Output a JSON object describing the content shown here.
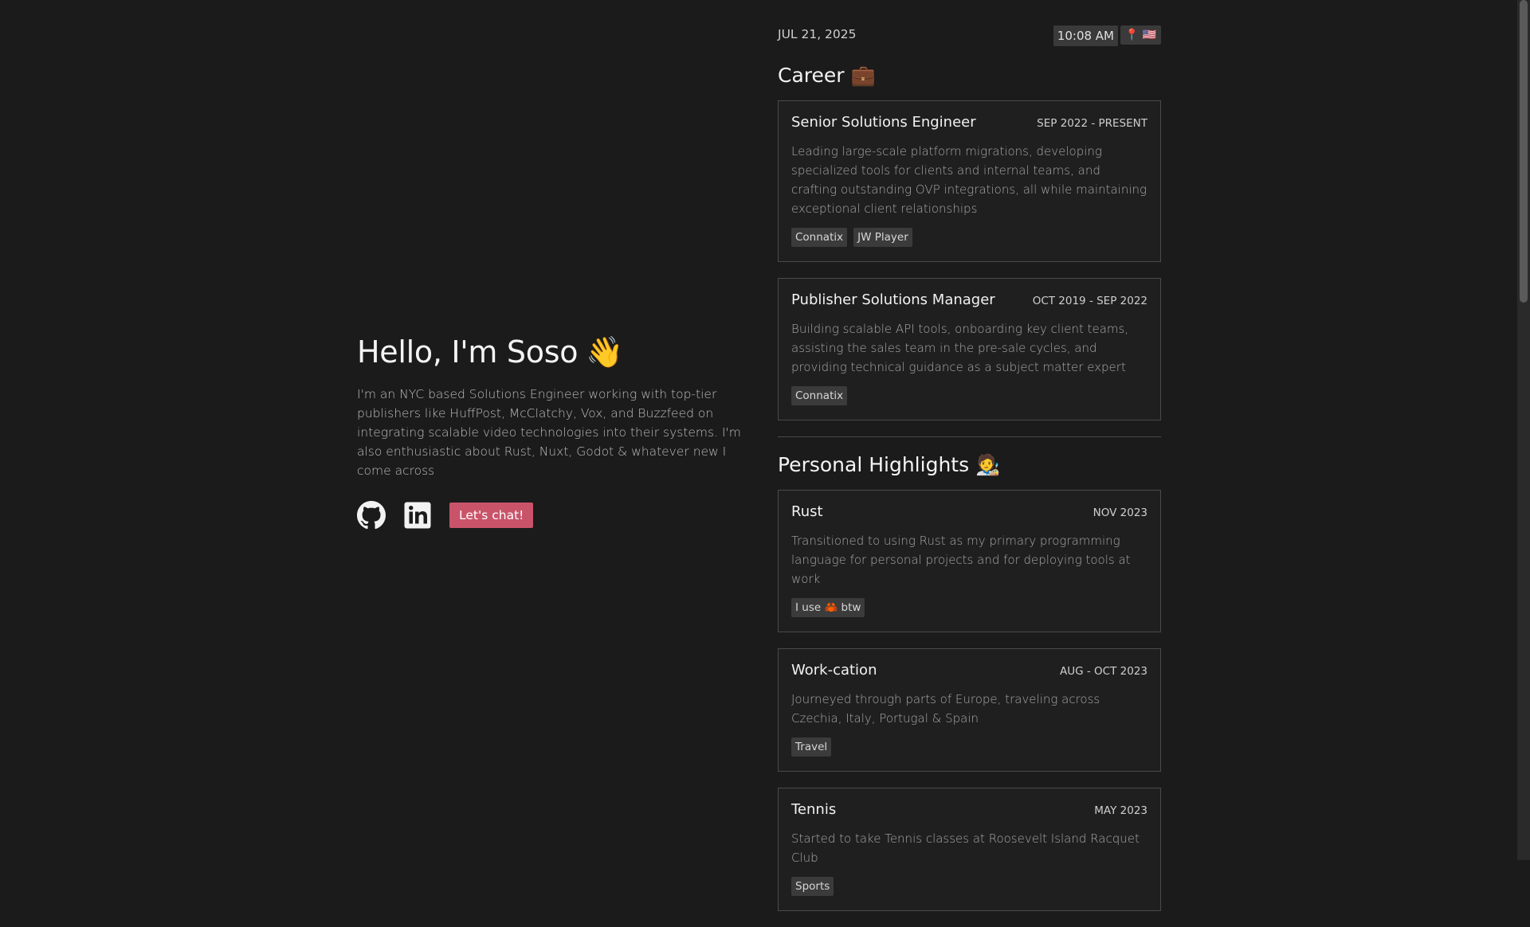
{
  "intro": {
    "greeting": "Hello, I'm Soso",
    "wave": "👋",
    "bio": "I'm an NYC based Solutions Engineer working with top-tier publishers like HuffPost, McClatchy, Vox, and Buzzfeed on integrating scalable video technologies into their systems. I'm also enthusiastic about Rust, Nuxt, Godot & whatever new I come across",
    "chat_button": "Let's chat!"
  },
  "topbar": {
    "date": "JUL 21, 2025",
    "time": "10:08 AM",
    "location": "📍 🇺🇸"
  },
  "career": {
    "title": "Career 💼",
    "items": [
      {
        "title": "Senior Solutions Engineer",
        "date": "SEP 2022 - PRESENT",
        "desc": "Leading large-scale platform migrations, developing specialized tools for clients and internal teams, and crafting outstanding OVP integrations, all while maintaining exceptional client relationships",
        "tags": [
          "Connatix",
          "JW Player"
        ]
      },
      {
        "title": "Publisher Solutions Manager",
        "date": "OCT 2019 - SEP 2022",
        "desc": "Building scalable API tools, onboarding key client teams, assisting the sales team in the pre-sale cycles, and providing technical guidance as a subject matter expert",
        "tags": [
          "Connatix"
        ]
      }
    ]
  },
  "highlights": {
    "title": "Personal Highlights 🧑‍🎨",
    "items": [
      {
        "title": "Rust",
        "date": "NOV 2023",
        "desc": "Transitioned to using Rust as my primary programming language for personal projects and for deploying tools at work",
        "tags": [
          "I use 🦀 btw"
        ]
      },
      {
        "title": "Work-cation",
        "date": "AUG - OCT 2023",
        "desc": "Journeyed through parts of Europe, traveling across Czechia, Italy, Portugal & Spain",
        "tags": [
          "Travel"
        ]
      },
      {
        "title": "Tennis",
        "date": "MAY 2023",
        "desc": "Started to take Tennis classes at Roosevelt Island Racquet Club",
        "tags": [
          "Sports"
        ]
      }
    ]
  }
}
